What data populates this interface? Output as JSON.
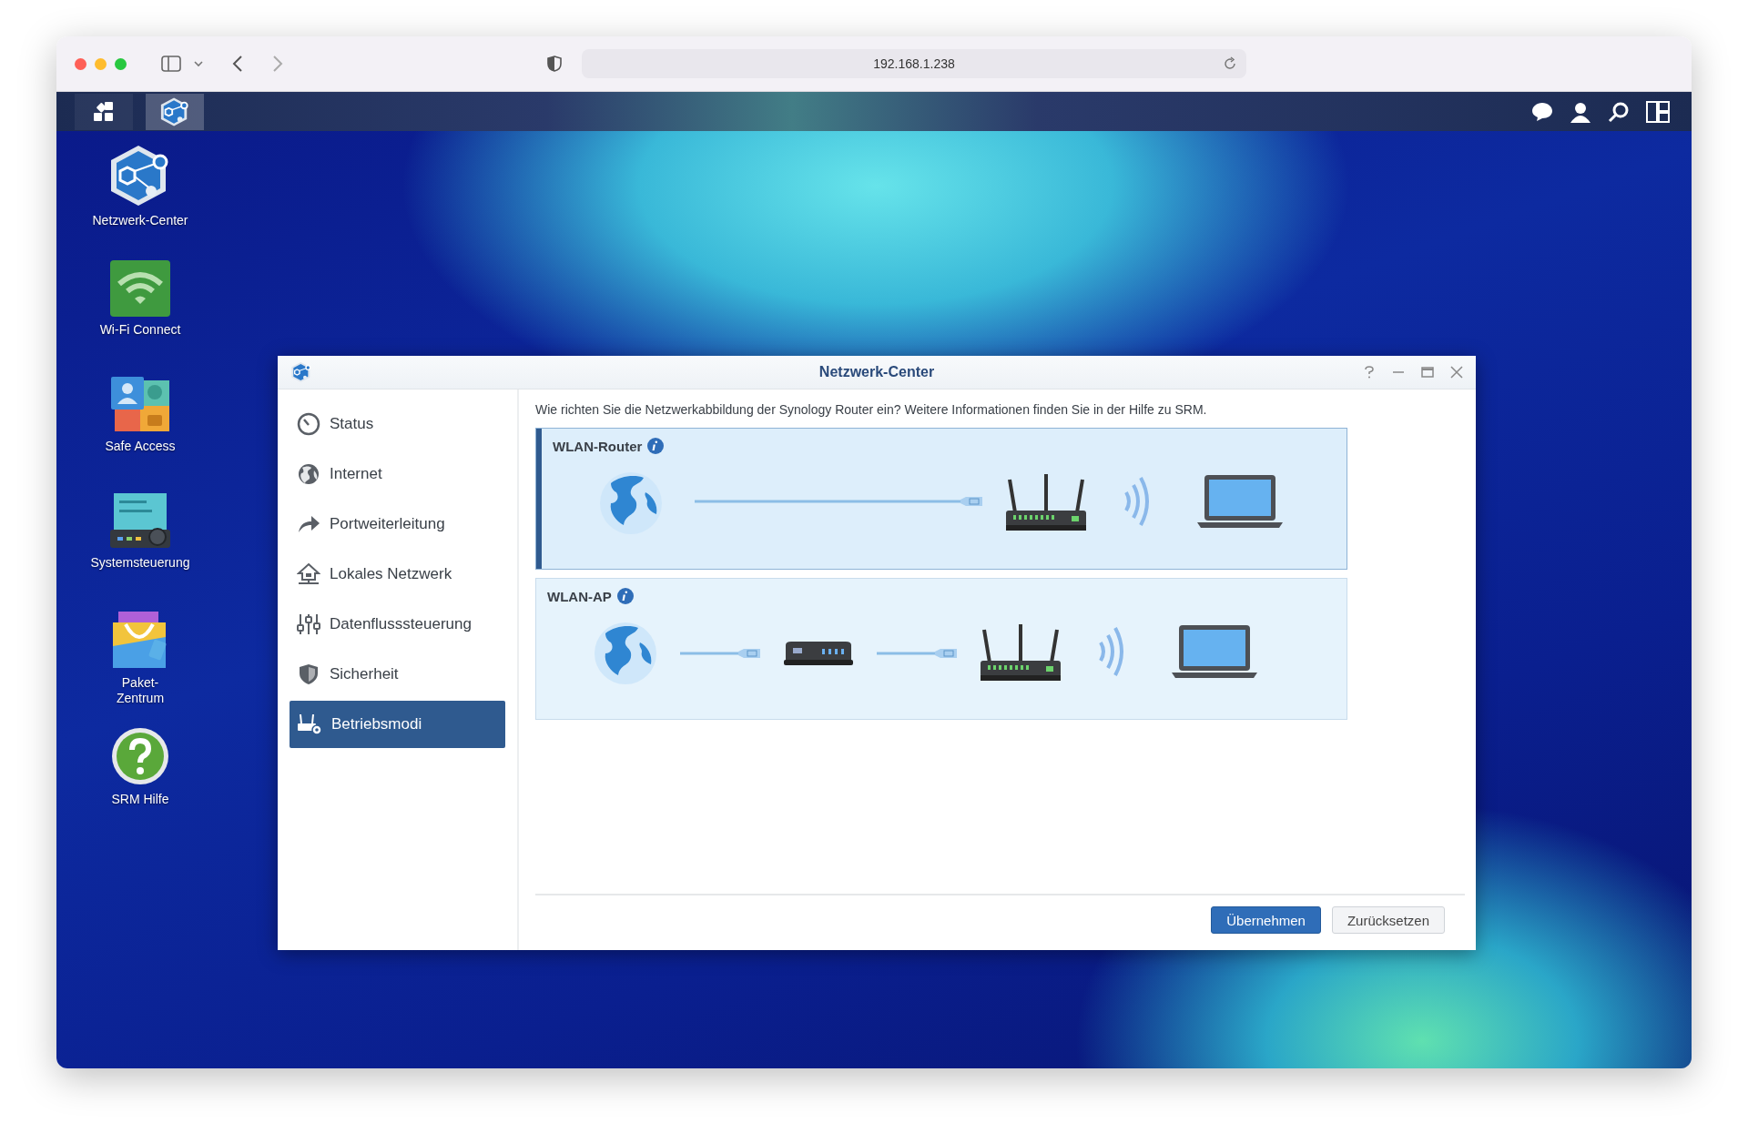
{
  "browser": {
    "address": "192.168.1.238"
  },
  "desktop_icons": [
    {
      "label": "Netzwerk-Center",
      "kind": "network"
    },
    {
      "label": "Wi-Fi Connect",
      "kind": "wifi"
    },
    {
      "label": "Safe Access",
      "kind": "safe"
    },
    {
      "label": "Systemsteuerung",
      "kind": "control"
    },
    {
      "label": "Paket-\nZentrum",
      "kind": "package"
    },
    {
      "label": "SRM Hilfe",
      "kind": "help"
    }
  ],
  "window": {
    "title": "Netzwerk-Center",
    "sidebar": {
      "items": [
        {
          "label": "Status",
          "kind": "status",
          "selected": false
        },
        {
          "label": "Internet",
          "kind": "internet",
          "selected": false
        },
        {
          "label": "Portweiterleitung",
          "kind": "forward",
          "selected": false
        },
        {
          "label": "Lokales Netzwerk",
          "kind": "lan",
          "selected": false
        },
        {
          "label": "Datenflusssteuerung",
          "kind": "traffic",
          "selected": false
        },
        {
          "label": "Sicherheit",
          "kind": "security",
          "selected": false
        },
        {
          "label": "Betriebsmodi",
          "kind": "modes",
          "selected": true
        }
      ]
    },
    "intro": "Wie richten Sie die Netzwerkabbildung der Synology Router ein? Weitere Informationen finden Sie in der Hilfe zu SRM.",
    "modes": [
      {
        "title": "WLAN-Router",
        "kind": "router",
        "selected": true
      },
      {
        "title": "WLAN-AP",
        "kind": "ap",
        "selected": false
      }
    ],
    "buttons": [
      {
        "label": "Übernehmen",
        "kind": "primary"
      },
      {
        "label": "Zurücksetzen",
        "kind": "secondary"
      }
    ]
  }
}
